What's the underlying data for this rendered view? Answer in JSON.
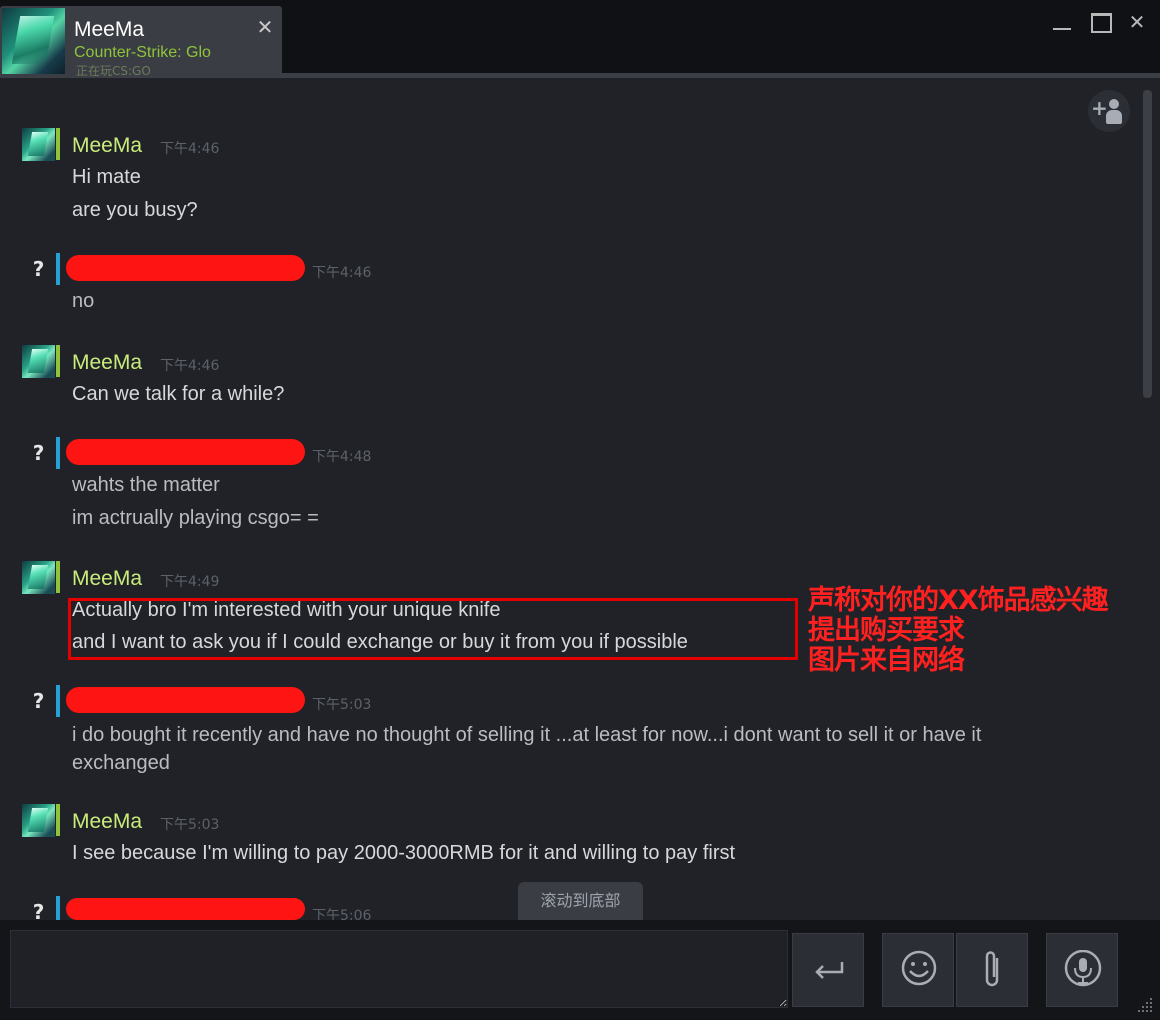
{
  "window": {
    "tab": {
      "name": "MeeMa",
      "game": "Counter-Strike: Glo",
      "status": "正在玩CS:GO",
      "close_icon": "close-icon"
    },
    "controls": [
      "minimize-icon",
      "maximize-icon",
      "close-icon"
    ]
  },
  "messages": [
    {
      "sender": "MeeMa",
      "time": "下午4:46",
      "lines": [
        "Hi mate",
        "are you busy?"
      ]
    },
    {
      "sender": "",
      "time": "下午4:46",
      "lines": [
        "no"
      ]
    },
    {
      "sender": "MeeMa",
      "time": "下午4:46",
      "lines": [
        "Can we talk for a while?"
      ]
    },
    {
      "sender": "",
      "time": "下午4:48",
      "lines": [
        "wahts the matter",
        "im actrually playing csgo= ="
      ]
    },
    {
      "sender": "MeeMa",
      "time": "下午4:49",
      "lines": [
        "Actually bro I'm interested with your unique knife",
        "and I want to ask you if I could exchange or buy it from you if possible"
      ]
    },
    {
      "sender": "",
      "time": "下午5:03",
      "lines": [
        "i do bought it recently and have no thought of selling it ...at least for now...i dont want to sell it or have it exchanged"
      ]
    },
    {
      "sender": "MeeMa",
      "time": "下午5:03",
      "lines": [
        "I see because I'm willing to pay 2000-3000RMB for it and willing to pay first"
      ]
    },
    {
      "sender": "",
      "time": "下午5:06",
      "lines": []
    }
  ],
  "unknown_avatar_glyph": "?",
  "annotation": [
    "声称对你的XX饰品感兴趣",
    "提出购买要求",
    "图片来自网络"
  ],
  "scroll_to_bottom": "滚动到底部",
  "input": {
    "placeholder": "",
    "buttons": [
      "send-icon",
      "emoji-icon",
      "attach-icon",
      "voice-icon"
    ]
  },
  "colors": {
    "sender_name": "#c9ec7a",
    "game_status": "#8fc43a",
    "redaction": "#ff1414",
    "annotation": "#ff2020"
  }
}
